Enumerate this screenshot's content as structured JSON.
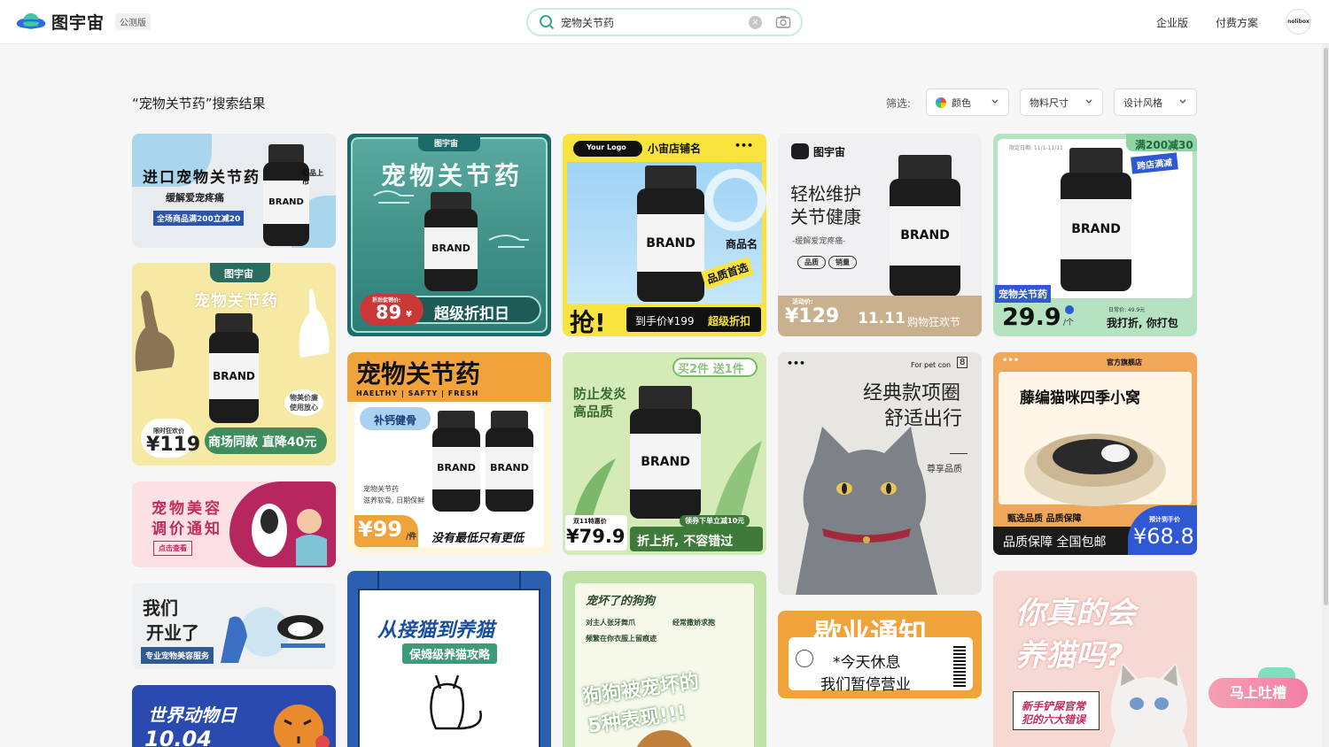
{
  "header": {
    "brand": "图宇宙",
    "beta_badge": "公测版",
    "search_value": "宠物关节药",
    "clear_symbol": "×",
    "enterprise": "企业版",
    "pricing": "付费方案",
    "avatar_text": "nolibox"
  },
  "results": {
    "title": "“宠物关节药”搜索结果",
    "filter_label": "筛选:",
    "filters": [
      "颜色",
      "物料尺寸",
      "设计风格"
    ]
  },
  "cards": {
    "c1": {
      "title": "进口宠物关节药",
      "sub": "缓解爱宠疼痛",
      "promo": "全场商品满200立减20",
      "tag": "新品上市",
      "brand": "BRAND"
    },
    "c2": {
      "top": "图宇宙",
      "title": "宠物关节药",
      "brand": "BRAND",
      "price_label": "折后促销价:",
      "price": "89",
      "yen": "¥",
      "slogan": "超级折扣日"
    },
    "c3": {
      "logo": "Your Logo",
      "shop": "小宙店铺名",
      "dots": "•••",
      "brand": "BRAND",
      "tag1": "商品名",
      "tag2": "品质首选",
      "grab": "抢!",
      "price": "到手价¥199",
      "deal": "超级折扣"
    },
    "c4": {
      "logo": "图宇宙",
      "title1": "轻松维护",
      "title2": "关节健康",
      "sub": "-缓解爱宠疼痛-",
      "tag1": "品质",
      "tag2": "销量",
      "brand": "BRAND",
      "price_label": "活动价:",
      "price": "¥129",
      "event": "11.11",
      "event_text": "购物狂欢节"
    },
    "c5": {
      "date": "限定日期: 11/1-11/11",
      "promo1": "满200减30",
      "promo2": "跨店满减",
      "brand": "BRAND",
      "name": "宠物关节药",
      "price": "29.9",
      "unit": "/个",
      "daily": "日常价: 49.9元",
      "slogan": "我打折, 你打包"
    },
    "c6": {
      "logo": "图宇宙",
      "title": "宠物关节药",
      "brand": "BRAND",
      "bubble": "物美价廉 使用放心",
      "limit": "限时狂欢价",
      "price": "¥119",
      "slogan": "商场同款 直降40元"
    },
    "c7": {
      "title": "宠物关节药",
      "sub": "HAELTHY | SAFTY | FRESH",
      "tag": "补钙健骨",
      "brand1": "BRAND",
      "brand2": "BRAND",
      "desc1": "宠物关节药",
      "desc2": "滋养软骨, 日期保鲜",
      "price": "¥99",
      "unit": "/件",
      "slogan": "没有最低只有更低"
    },
    "c8": {
      "promo": "买2件 送1件",
      "title1": "防止发炎",
      "title2": "高品质",
      "brand": "BRAND",
      "deal_label": "双11特惠价",
      "price": "¥79.9",
      "coupon": "领券下单立减10元",
      "slogan": "折上折, 不容错过"
    },
    "c9": {
      "dots": "•••",
      "brand_line": "For pet con",
      "count": "8",
      "title1": "经典款项圈",
      "title2": "舒适出行",
      "sub": "尊享品质"
    },
    "c10": {
      "logo": "官方旗舰店",
      "title": "藤编猫咪四季小窝",
      "sub": "甄选品质 品质保障",
      "bar": "品质保障 全国包邮",
      "est": "预计到手价",
      "price": "¥68.8"
    },
    "c11": {
      "title": "宠物美容",
      "title2": "调价通知",
      "btn": "点击查看"
    },
    "c12": {
      "title1": "我们",
      "title2": "开业了",
      "sub": "专业宠物美容服务"
    },
    "c13": {
      "title": "世界动物日",
      "date": "10.04"
    },
    "c14": {
      "title": "从接猫到养猫",
      "sub": "保姆级养猫攻略"
    },
    "c15": {
      "title": "宠坏了的狗狗",
      "item1": "对主人张牙舞爪",
      "item2": "经常撒娇求抱",
      "item3": "频繁在你衣服上留痕迹",
      "headline1": "狗狗被宠坏的",
      "headline2": "5种表现!!!"
    },
    "c16": {
      "title": "歇业通知",
      "line1": "*今天休息",
      "line2": "我们暂停营业"
    },
    "c17": {
      "title1": "你真的会",
      "title2": "养猫吗?",
      "sub1": "新手铲屎官常",
      "sub2": "犯的六大错误"
    }
  },
  "feedback": "马上吐槽"
}
